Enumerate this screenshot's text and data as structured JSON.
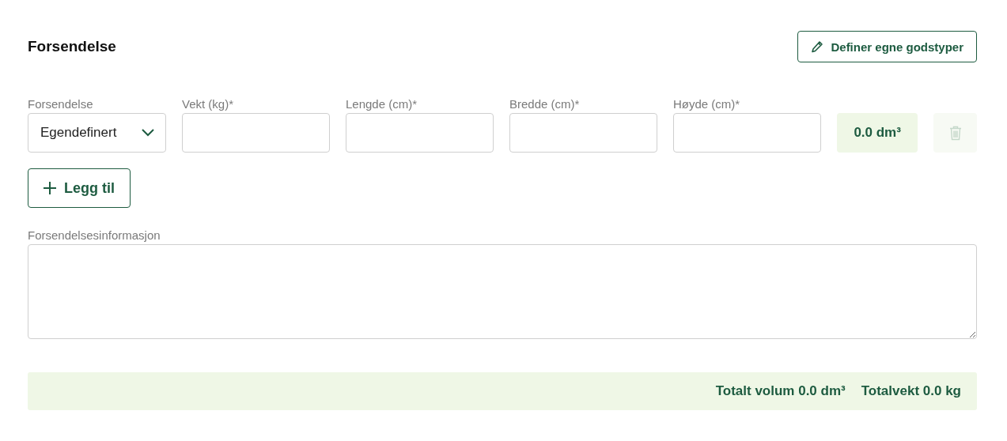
{
  "header": {
    "title": "Forsendelse",
    "define_button": "Definer egne godstyper"
  },
  "package_row": {
    "type_field": {
      "label": "Forsendelse",
      "value": "Egendefinert"
    },
    "dimension_fields": [
      {
        "label": "Vekt (kg)*"
      },
      {
        "label": "Lengde (cm)*"
      },
      {
        "label": "Bredde (cm)*"
      },
      {
        "label": "Høyde (cm)*"
      }
    ],
    "volume": "0.0 dm³",
    "delete_disabled": true
  },
  "add_button": "Legg til",
  "info_field": {
    "label": "Forsendelsesinformasjon"
  },
  "summary": {
    "total_volume": "Totalt volum 0.0 dm³",
    "total_weight": "Totalvekt 0.0 kg"
  }
}
